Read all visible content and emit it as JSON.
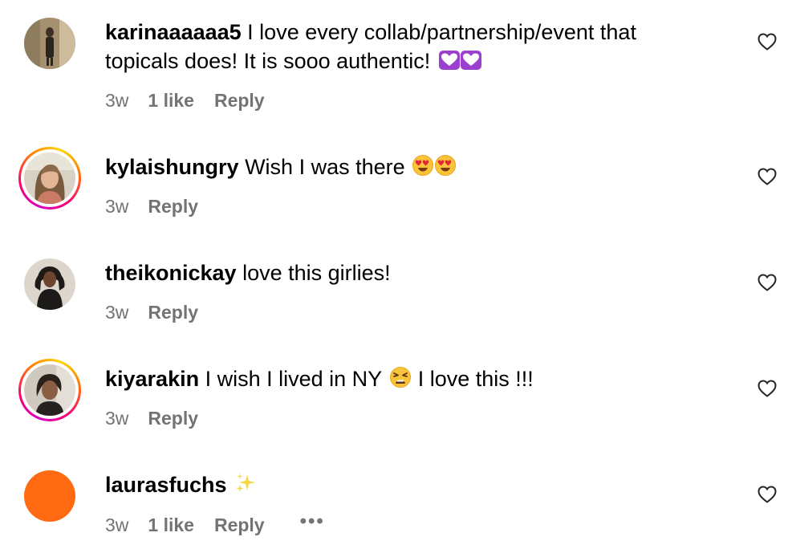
{
  "comments": [
    {
      "username": "karinaaaaaa5",
      "text": "I love every collab/partnership/event that topicals does! It is sooo authentic!",
      "emoji": "💟💟",
      "time": "3w",
      "likes": "1 like",
      "reply": "Reply",
      "has_story": false
    },
    {
      "username": "kylaishungry",
      "text": "Wish I was there",
      "emoji": "😍😍",
      "time": "3w",
      "likes": "",
      "reply": "Reply",
      "has_story": true
    },
    {
      "username": "theikonickay",
      "text": "love this girlies!",
      "time": "3w",
      "likes": "",
      "reply": "Reply",
      "has_story": false
    },
    {
      "username": "kiyarakin",
      "text": "I wish I lived in NY",
      "emoji": "😫",
      "text_after": "I love this !!!",
      "time": "3w",
      "likes": "",
      "reply": "Reply",
      "has_story": true
    },
    {
      "username": "laurasfuchs",
      "emoji": "✨",
      "time": "3w",
      "likes": "1 like",
      "reply": "Reply",
      "more": "•••",
      "has_story": false
    }
  ],
  "colors": {
    "meta_text": "#737373",
    "orange_avatar": "#ff6a13"
  },
  "icons": {
    "like": "heart-outline-icon",
    "more": "more-horizontal-icon"
  }
}
